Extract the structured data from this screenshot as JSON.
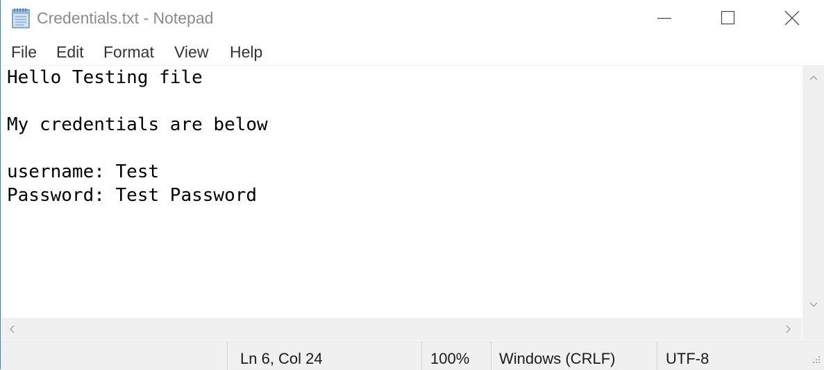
{
  "window": {
    "title": "Credentials.txt - Notepad",
    "icon": "notepad-icon",
    "controls": [
      "minimize-icon",
      "maximize-icon",
      "close-icon"
    ]
  },
  "menu": {
    "file": "File",
    "edit": "Edit",
    "format": "Format",
    "view": "View",
    "help": "Help"
  },
  "editor": {
    "lines": [
      "Hello Testing file",
      "",
      "My credentials are below",
      "",
      "username: Test",
      "Password: Test Password"
    ]
  },
  "status": {
    "position": "Ln 6, Col 24",
    "zoom": "100%",
    "line_ending": "Windows (CRLF)",
    "encoding": "UTF-8"
  },
  "colors": {
    "title_text": "#8a8a8a",
    "chrome_background": "#f0f0f0",
    "window_border": "#4a7fb5"
  }
}
